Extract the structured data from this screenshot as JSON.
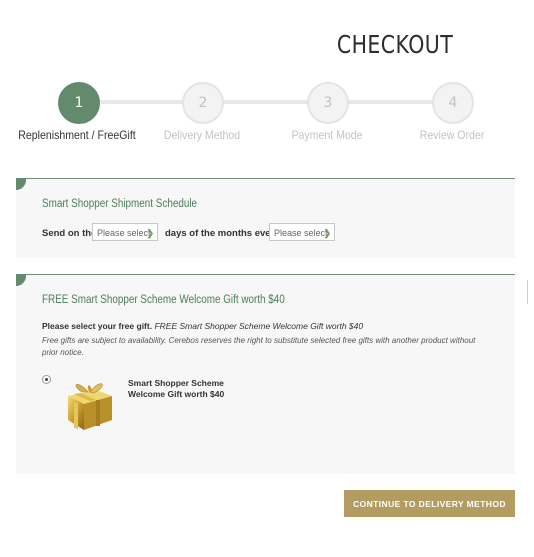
{
  "page": {
    "title": "CHECKOUT"
  },
  "steps": [
    {
      "number": "1",
      "label": "Replenishment / FreeGift",
      "state": "active"
    },
    {
      "number": "2",
      "label": "Delivery Method",
      "state": "inactive"
    },
    {
      "number": "3",
      "label": "Payment Mode",
      "state": "inactive"
    },
    {
      "number": "4",
      "label": "Review Order",
      "state": "inactive"
    }
  ],
  "schedule": {
    "heading": "Smart Shopper Shipment Schedule",
    "send_on_label": "Send on the",
    "day_select": {
      "value": "Please select"
    },
    "days_text": "days of the months every",
    "month_select": {
      "value": "Please select"
    }
  },
  "gift": {
    "heading": "FREE Smart Shopper Scheme Welcome Gift worth $40",
    "select_label": "Please select your free gift.",
    "selected_value": "FREE Smart Shopper Scheme Welcome Gift worth $40",
    "note": "Free gifts are subject to availability. Cerebos reserves the right to substitute selected free gifts with another product without prior notice.",
    "option": {
      "name_line1": "Smart Shopper Scheme",
      "name_line2": "Welcome Gift worth $40",
      "selected": true
    }
  },
  "actions": {
    "continue_label": "CONTINUE TO DELIVERY METHOD"
  },
  "colors": {
    "accent_green": "#648a6d",
    "gold_button": "#b39c62"
  }
}
